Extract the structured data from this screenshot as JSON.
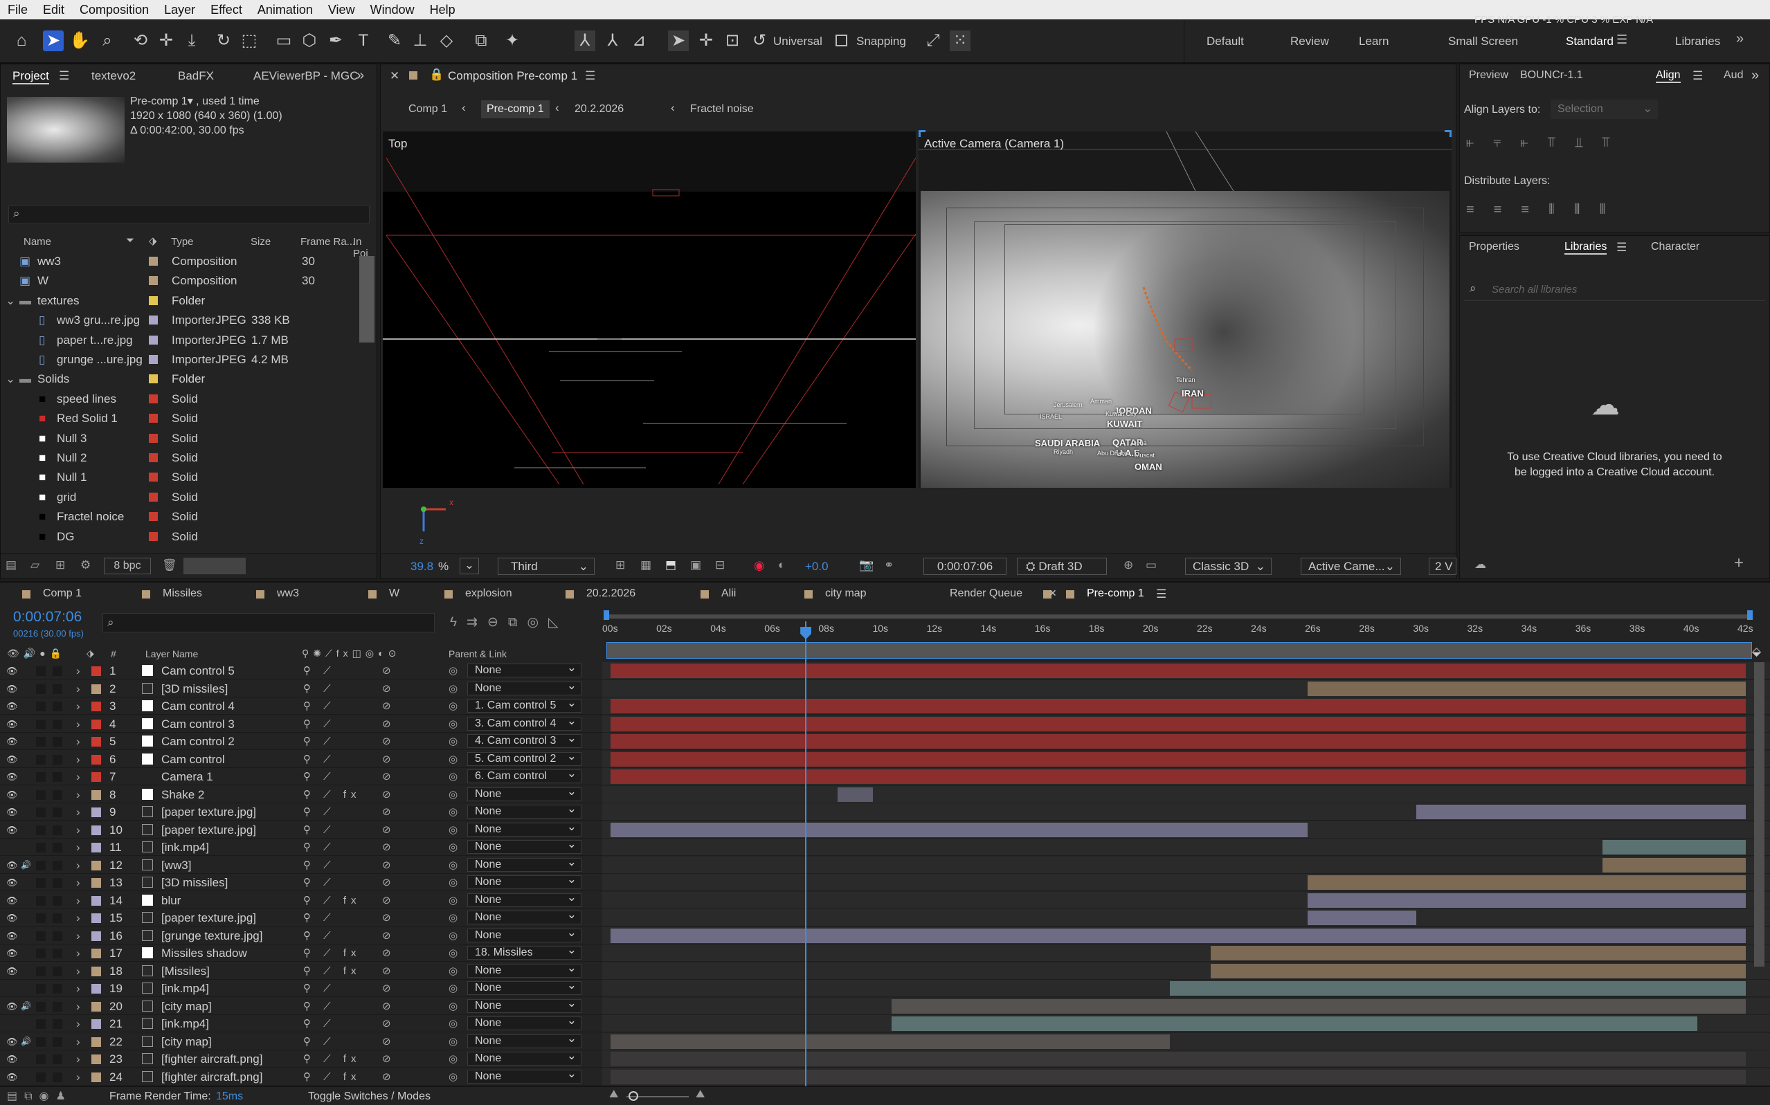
{
  "menu": [
    "File",
    "Edit",
    "Composition",
    "Layer",
    "Effect",
    "Animation",
    "View",
    "Window",
    "Help"
  ],
  "toolbar": {
    "universal": "Universal",
    "snapping": "Snapping",
    "top_status": "FPS N/A   GPU -1 %   CPU 3 %   EXP N/A"
  },
  "workspaces": [
    "Default",
    "Review",
    "Learn",
    "Small Screen",
    "Standard",
    "Libraries"
  ],
  "project": {
    "tabs": [
      "Project",
      "textevo2",
      "BadFX",
      "AEViewerBP - MGC"
    ],
    "info_title": "Pre-comp 1▾ , used 1 time",
    "info_line2": "1920 x 1080  (640 x 360) (1.00)",
    "info_line3": "Δ 0:00:42:00, 30.00 fps",
    "search_placeholder": "",
    "headers": [
      "Name",
      "Type",
      "Size",
      "Frame Ra...",
      "In Poi"
    ],
    "items": [
      {
        "name": "ww3",
        "type": "Composition",
        "size": "",
        "fps": "30",
        "color": "#b79c7c",
        "indent": 0
      },
      {
        "name": "W",
        "type": "Composition",
        "size": "",
        "fps": "30",
        "color": "#b79c7c",
        "indent": 0
      },
      {
        "name": "textures",
        "type": "Folder",
        "size": "",
        "fps": "",
        "color": "#e2c44f",
        "indent": 0
      },
      {
        "name": "ww3 gru...re.jpg",
        "type": "ImporterJPEG",
        "size": "338 KB",
        "fps": "",
        "color": "#a9a6c8",
        "indent": 1
      },
      {
        "name": "paper t...re.jpg",
        "type": "ImporterJPEG",
        "size": "1.7 MB",
        "fps": "",
        "color": "#a9a6c8",
        "indent": 1
      },
      {
        "name": "grunge ...ure.jpg",
        "type": "ImporterJPEG",
        "size": "4.2 MB",
        "fps": "",
        "color": "#a9a6c8",
        "indent": 1
      },
      {
        "name": "Solids",
        "type": "Folder",
        "size": "",
        "fps": "",
        "color": "#e2c44f",
        "indent": 0
      },
      {
        "name": "speed lines",
        "type": "Solid",
        "size": "",
        "fps": "",
        "color": "#cc3b30",
        "indent": 1
      },
      {
        "name": "Red Solid 1",
        "type": "Solid",
        "size": "",
        "fps": "",
        "color": "#cc3b30",
        "indent": 1
      },
      {
        "name": "Null 3",
        "type": "Solid",
        "size": "",
        "fps": "",
        "color": "#cc3b30",
        "indent": 1
      },
      {
        "name": "Null 2",
        "type": "Solid",
        "size": "",
        "fps": "",
        "color": "#cc3b30",
        "indent": 1
      },
      {
        "name": "Null 1",
        "type": "Solid",
        "size": "",
        "fps": "",
        "color": "#cc3b30",
        "indent": 1
      },
      {
        "name": "grid",
        "type": "Solid",
        "size": "",
        "fps": "",
        "color": "#cc3b30",
        "indent": 1
      },
      {
        "name": "Fractel noice",
        "type": "Solid",
        "size": "",
        "fps": "",
        "color": "#cc3b30",
        "indent": 1
      },
      {
        "name": "DG",
        "type": "Solid",
        "size": "",
        "fps": "",
        "color": "#cc3b30",
        "indent": 1
      }
    ],
    "bpc": "8 bpc"
  },
  "comp_viewer": {
    "tab": "Composition Pre-comp 1",
    "breadcrumbs": [
      "Comp 1",
      "Pre-comp 1",
      "20.2.2026",
      "Fractel noise"
    ],
    "left_view_label": "Top",
    "right_view_label": "Active Camera (Camera 1)",
    "map_labels": [
      "JORDAN",
      "IRAN",
      "KUWAIT",
      "SAUDI ARABIA",
      "QATAR",
      "U.A.E",
      "OMAN",
      "ISRAEL",
      "Tehran",
      "Riyadh",
      "Doha",
      "Abu Dhabi",
      "Muscat",
      "Amman",
      "Jerusalem",
      "Kuwait City"
    ],
    "zoom": "39.8",
    "zoom_unit": "%",
    "view_select": "Third",
    "exposure": "+0.0",
    "timecode": "0:00:07:06",
    "draft": "Draft 3D",
    "renderer": "Classic 3D",
    "camera": "Active Came...",
    "views": "2 V"
  },
  "right_panel": {
    "tabs_top": [
      "Preview",
      "BOUNCr-1.1",
      "Align",
      "Aud"
    ],
    "align_to_label": "Align Layers to:",
    "align_to_value": "Selection",
    "distribute_label": "Distribute Layers:",
    "tabs_bottom": [
      "Properties",
      "Libraries",
      "Character"
    ],
    "search_placeholder": "Search all libraries",
    "cc_message": "To use Creative Cloud libraries, you need to be logged into a Creative Cloud account."
  },
  "timeline": {
    "tabs": [
      "Comp 1",
      "Missiles",
      "ww3",
      "W",
      "explosion",
      "20.2.2026",
      "Alii",
      "city map",
      "Render Queue",
      "Pre-comp 1"
    ],
    "tab_colors": [
      "#b79c7c",
      "#b79c7c",
      "#b79c7c",
      "#b79c7c",
      "#b79c7c",
      "#b79c7c",
      "#b79c7c",
      "#b79c7c",
      "",
      "#b79c7c"
    ],
    "timecode": "0:00:07:06",
    "frames": "00216 (30.00 fps)",
    "col_layer": "Layer Name",
    "col_parent": "Parent & Link",
    "ruler": [
      "00s",
      "02s",
      "04s",
      "06s",
      "08s",
      "10s",
      "12s",
      "14s",
      "16s",
      "18s",
      "20s",
      "22s",
      "24s",
      "26s",
      "28s",
      "30s",
      "32s",
      "34s",
      "36s",
      "38s",
      "40s",
      "42s"
    ],
    "duration_s": 42,
    "playhead_s": 7.2,
    "layers": [
      {
        "n": "1",
        "name": "Cam control 5",
        "color": "#cc3b30",
        "parent": "None",
        "start": 0,
        "end": 42,
        "bar": "#8a2e2e"
      },
      {
        "n": "2",
        "name": "[3D missiles]",
        "color": "#b79c7c",
        "parent": "None",
        "start": 25.8,
        "end": 42,
        "bar": "#7c6a55"
      },
      {
        "n": "3",
        "name": "Cam control 4",
        "color": "#cc3b30",
        "parent": "1. Cam control 5",
        "start": 0,
        "end": 42,
        "bar": "#8a2e2e"
      },
      {
        "n": "4",
        "name": "Cam control 3",
        "color": "#cc3b30",
        "parent": "3. Cam control 4",
        "start": 0,
        "end": 42,
        "bar": "#8a2e2e"
      },
      {
        "n": "5",
        "name": "Cam control 2",
        "color": "#cc3b30",
        "parent": "4. Cam control 3",
        "start": 0,
        "end": 42,
        "bar": "#8a2e2e"
      },
      {
        "n": "6",
        "name": "Cam control",
        "color": "#cc3b30",
        "parent": "5. Cam control 2",
        "start": 0,
        "end": 42,
        "bar": "#8a2e2e"
      },
      {
        "n": "7",
        "name": "Camera 1",
        "color": "#cc3b30",
        "parent": "6. Cam control",
        "start": 0,
        "end": 42,
        "bar": "#8a2e2e"
      },
      {
        "n": "8",
        "name": "Shake 2",
        "color": "#b79c7c",
        "parent": "None",
        "start": 8.4,
        "end": 9.7,
        "bar": "#5b5b6a"
      },
      {
        "n": "9",
        "name": "[paper texture.jpg]",
        "color": "#a9a6c8",
        "parent": "None",
        "start": 29.8,
        "end": 42,
        "bar": "#6e6c85"
      },
      {
        "n": "10",
        "name": "[paper texture.jpg]",
        "color": "#a9a6c8",
        "parent": "None",
        "start": 0,
        "end": 25.8,
        "bar": "#6e6c85"
      },
      {
        "n": "11",
        "name": "[ink.mp4]",
        "color": "#a9a6c8",
        "parent": "None",
        "start": 36.7,
        "end": 42,
        "bar": "#5c7272"
      },
      {
        "n": "12",
        "name": "[ww3]",
        "color": "#b79c7c",
        "parent": "None",
        "start": 36.7,
        "end": 42,
        "bar": "#7c6a55"
      },
      {
        "n": "13",
        "name": "[3D missiles]",
        "color": "#b79c7c",
        "parent": "None",
        "start": 25.8,
        "end": 42,
        "bar": "#7c6a55"
      },
      {
        "n": "14",
        "name": "blur",
        "color": "#a9a6c8",
        "parent": "None",
        "start": 25.8,
        "end": 42,
        "bar": "#6e6c85"
      },
      {
        "n": "15",
        "name": "[paper texture.jpg]",
        "color": "#a9a6c8",
        "parent": "None",
        "start": 25.8,
        "end": 29.8,
        "bar": "#6e6c85"
      },
      {
        "n": "16",
        "name": "[grunge texture.jpg]",
        "color": "#a9a6c8",
        "parent": "None",
        "start": 0,
        "end": 42,
        "bar": "#6e6c85"
      },
      {
        "n": "17",
        "name": "Missiles shadow",
        "color": "#b79c7c",
        "parent": "18. Missiles",
        "start": 22.2,
        "end": 42,
        "bar": "#7c6a55"
      },
      {
        "n": "18",
        "name": "[Missiles]",
        "color": "#b79c7c",
        "parent": "None",
        "start": 22.2,
        "end": 42,
        "bar": "#7c6a55"
      },
      {
        "n": "19",
        "name": "[ink.mp4]",
        "color": "#a9a6c8",
        "parent": "None",
        "start": 20.7,
        "end": 42,
        "bar": "#5c7272"
      },
      {
        "n": "20",
        "name": "[city map]",
        "color": "#b79c7c",
        "parent": "None",
        "start": 10.4,
        "end": 42,
        "bar": "#55524f"
      },
      {
        "n": "21",
        "name": "[ink.mp4]",
        "color": "#a9a6c8",
        "parent": "None",
        "start": 10.4,
        "end": 40.2,
        "bar": "#5c7272"
      },
      {
        "n": "22",
        "name": "[city map]",
        "color": "#b79c7c",
        "parent": "None",
        "start": 0,
        "end": 20.7,
        "bar": "#55524f"
      },
      {
        "n": "23",
        "name": "[fighter aircraft.png]",
        "color": "#b79c7c",
        "parent": "None",
        "start": 0,
        "end": 42,
        "bar": "#3a3838"
      },
      {
        "n": "24",
        "name": "[fighter aircraft.png]",
        "color": "#b79c7c",
        "parent": "None",
        "start": 0,
        "end": 42,
        "bar": "#3a3838"
      }
    ],
    "render_time_label": "Frame Render Time:",
    "render_time": "15ms",
    "toggle_label": "Toggle Switches / Modes"
  }
}
